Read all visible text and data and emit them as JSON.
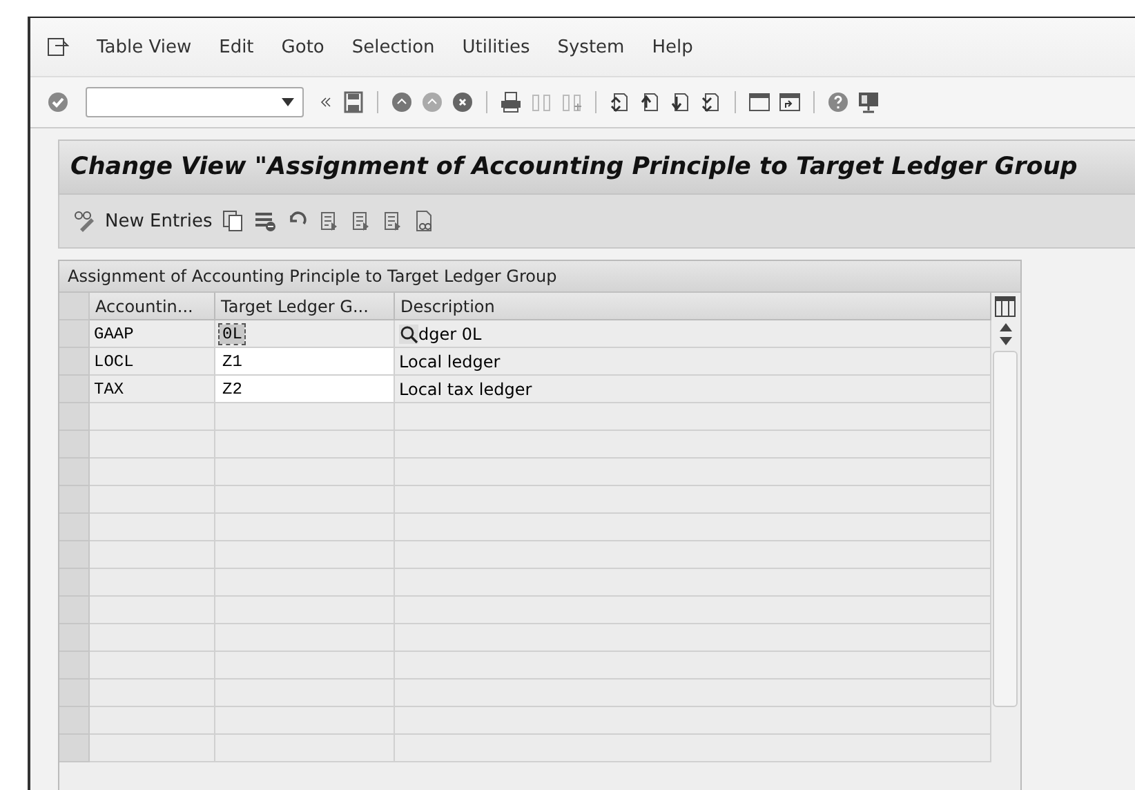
{
  "menu": [
    "Table View",
    "Edit",
    "Goto",
    "Selection",
    "Utilities",
    "System",
    "Help"
  ],
  "title": "Change View \"Assignment of Accounting Principle to Target Ledger Group",
  "app_toolbar": {
    "new_entries": "New Entries"
  },
  "table": {
    "caption": "Assignment of Accounting Principle to Target Ledger Group",
    "columns": [
      "Accountin...",
      "Target Ledger G...",
      "Description"
    ],
    "rows": [
      {
        "cells": [
          "GAAP",
          "0L",
          "dger 0L"
        ],
        "focused": true
      },
      {
        "cells": [
          "LOCL",
          "Z1",
          "Local ledger"
        ],
        "focused": false
      },
      {
        "cells": [
          "TAX",
          "Z2",
          "Local tax ledger"
        ],
        "focused": false
      }
    ]
  }
}
